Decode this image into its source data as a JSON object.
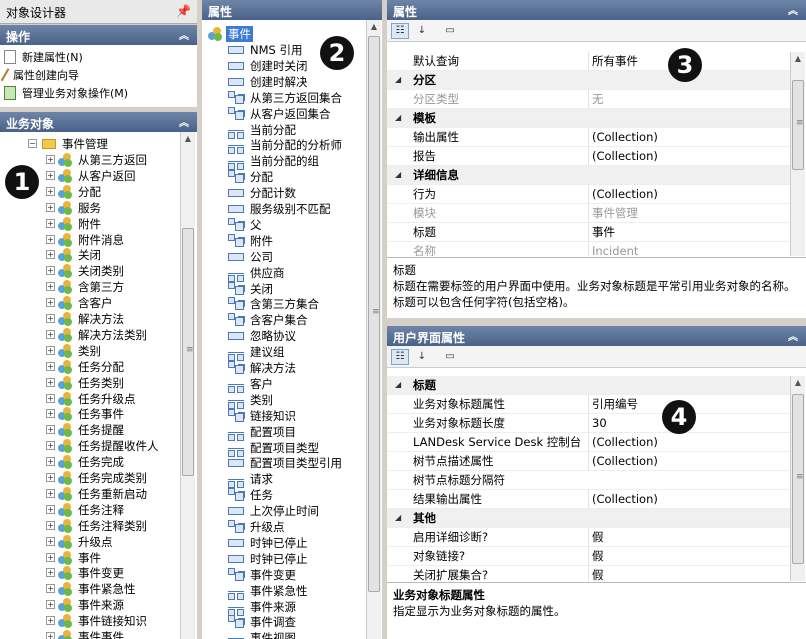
{
  "designer": {
    "title": "对象设计器",
    "pin": "Ҏ"
  },
  "operations": {
    "header": "操作",
    "items": [
      "新建属性(N)",
      "属性创建向导",
      "管理业务对象操作(M)"
    ]
  },
  "business_objects": {
    "header": "业务对象",
    "root": "事件管理",
    "items": [
      "从第三方返回",
      "从客户返回",
      "分配",
      "服务",
      "附件",
      "附件消息",
      "关闭",
      "关闭类别",
      "含第三方",
      "含客户",
      "解决方法",
      "解决方法类别",
      "类别",
      "任务分配",
      "任务类别",
      "任务升级点",
      "任务事件",
      "任务提醒",
      "任务提醒收件人",
      "任务完成",
      "任务完成类别",
      "任务重新启动",
      "任务注释",
      "任务注释类别",
      "升级点",
      "事件",
      "事件变更",
      "事件紧急性",
      "事件来源",
      "事件链接知识",
      "事件事件"
    ]
  },
  "attributes": {
    "header": "属性",
    "root": "事件",
    "items": [
      {
        "label": "NMS 引用",
        "kind": "field"
      },
      {
        "label": "创建时关闭",
        "kind": "field"
      },
      {
        "label": "创建时解决",
        "kind": "field"
      },
      {
        "label": "从第三方返回集合",
        "kind": "coll"
      },
      {
        "label": "从客户返回集合",
        "kind": "coll"
      },
      {
        "label": "当前分配",
        "kind": "rel"
      },
      {
        "label": "当前分配的分析师",
        "kind": "rel"
      },
      {
        "label": "当前分配的组",
        "kind": "rel"
      },
      {
        "label": "分配",
        "kind": "coll"
      },
      {
        "label": "分配计数",
        "kind": "field"
      },
      {
        "label": "服务级别不匹配",
        "kind": "field"
      },
      {
        "label": "父",
        "kind": "coll"
      },
      {
        "label": "附件",
        "kind": "coll"
      },
      {
        "label": "公司",
        "kind": "field"
      },
      {
        "label": "供应商",
        "kind": "rel"
      },
      {
        "label": "关闭",
        "kind": "coll"
      },
      {
        "label": "含第三方集合",
        "kind": "coll"
      },
      {
        "label": "含客户集合",
        "kind": "coll"
      },
      {
        "label": "忽略协议",
        "kind": "field"
      },
      {
        "label": "建议组",
        "kind": "rel"
      },
      {
        "label": "解决方法",
        "kind": "coll"
      },
      {
        "label": "客户",
        "kind": "rel"
      },
      {
        "label": "类别",
        "kind": "rel"
      },
      {
        "label": "链接知识",
        "kind": "coll"
      },
      {
        "label": "配置项目",
        "kind": "rel"
      },
      {
        "label": "配置项目类型",
        "kind": "rel"
      },
      {
        "label": "配置项目类型引用",
        "kind": "field"
      },
      {
        "label": "请求",
        "kind": "rel"
      },
      {
        "label": "任务",
        "kind": "coll"
      },
      {
        "label": "上次停止时间",
        "kind": "field"
      },
      {
        "label": "升级点",
        "kind": "coll"
      },
      {
        "label": "时钟已停止",
        "kind": "field"
      },
      {
        "label": "时钟已停止",
        "kind": "field"
      },
      {
        "label": "事件变更",
        "kind": "coll"
      },
      {
        "label": "事件紧急性",
        "kind": "rel"
      },
      {
        "label": "事件来源",
        "kind": "rel"
      },
      {
        "label": "事件调查",
        "kind": "coll"
      },
      {
        "label": "事件视图",
        "kind": "rel"
      }
    ]
  },
  "properties": {
    "header": "属性",
    "rows": [
      {
        "type": "row",
        "k": "默认查询",
        "v": "所有事件"
      },
      {
        "type": "cat",
        "k": "分区"
      },
      {
        "type": "dis",
        "k": "分区类型",
        "v": "无"
      },
      {
        "type": "cat",
        "k": "模板"
      },
      {
        "type": "row",
        "k": "输出属性",
        "v": "(Collection)"
      },
      {
        "type": "row",
        "k": "报告",
        "v": "(Collection)"
      },
      {
        "type": "cat",
        "k": "详细信息"
      },
      {
        "type": "row",
        "k": "行为",
        "v": "(Collection)"
      },
      {
        "type": "dis",
        "k": "模块",
        "v": "事件管理"
      },
      {
        "type": "row",
        "k": "标题",
        "v": "事件"
      },
      {
        "type": "dis",
        "k": "名称",
        "v": "Incident"
      }
    ],
    "desc_title": "标题",
    "desc_text": "标题在需要标签的用户界面中使用。业务对象标题是平常引用业务对象的名称。标题可以包含任何字符(包括空格)。"
  },
  "ui_properties": {
    "header": "用户界面属性",
    "rows": [
      {
        "type": "cat",
        "k": "标题"
      },
      {
        "type": "row",
        "k": "业务对象标题属性",
        "v": "引用编号"
      },
      {
        "type": "row",
        "k": "业务对象标题长度",
        "v": "30"
      },
      {
        "type": "row",
        "k": "LANDesk Service Desk 控制台 标",
        "v": "(Collection)"
      },
      {
        "type": "row",
        "k": "树节点描述属性",
        "v": "(Collection)"
      },
      {
        "type": "row",
        "k": "树节点标题分隔符",
        "v": ""
      },
      {
        "type": "row",
        "k": "结果输出属性",
        "v": "(Collection)"
      },
      {
        "type": "cat",
        "k": "其他"
      },
      {
        "type": "row",
        "k": "启用详细诊断?",
        "v": "假"
      },
      {
        "type": "row",
        "k": "对象链接?",
        "v": "假"
      },
      {
        "type": "row",
        "k": "关闭扩展集合?",
        "v": "假"
      }
    ],
    "desc_title": "业务对象标题属性",
    "desc_text": "指定显示为业务对象标题的属性。"
  },
  "icons": {
    "collapse": "⌃",
    "pin": "pin-icon"
  },
  "callouts": [
    "❶",
    "❷",
    "❸",
    "❹"
  ]
}
